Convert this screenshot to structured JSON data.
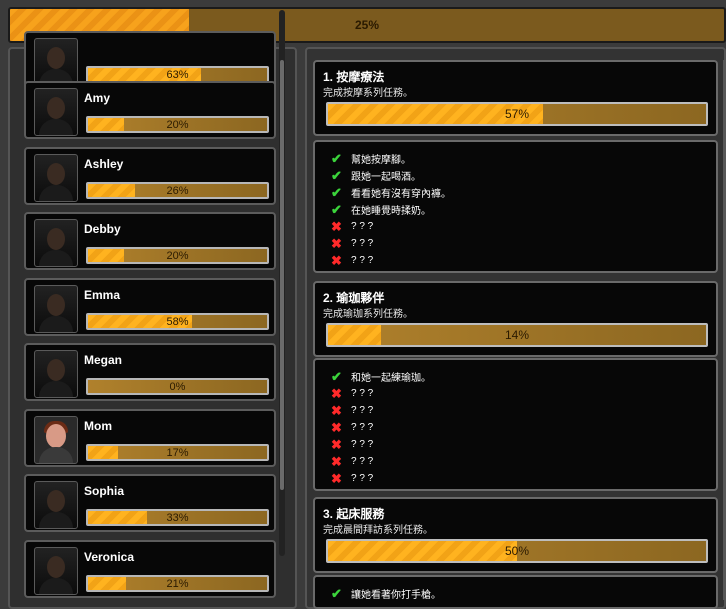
{
  "overall": {
    "progress_percent": 25,
    "label": "25%"
  },
  "characters": [
    {
      "name": "",
      "progress_percent": 63,
      "label": "63%"
    },
    {
      "name": "Amy",
      "progress_percent": 20,
      "label": "20%"
    },
    {
      "name": "Ashley",
      "progress_percent": 26,
      "label": "26%"
    },
    {
      "name": "Debby",
      "progress_percent": 20,
      "label": "20%"
    },
    {
      "name": "Emma",
      "progress_percent": 58,
      "label": "58%"
    },
    {
      "name": "Megan",
      "progress_percent": 0,
      "label": "0%"
    },
    {
      "name": "Mom",
      "progress_percent": 17,
      "label": "17%"
    },
    {
      "name": "Sophia",
      "progress_percent": 33,
      "label": "33%"
    },
    {
      "name": "Veronica",
      "progress_percent": 21,
      "label": "21%"
    }
  ],
  "quests": [
    {
      "title": "1. 按摩療法",
      "description": "完成按摩系列任務。",
      "progress_percent": 57,
      "label": "57%",
      "tasks": [
        {
          "status": "done",
          "text": "幫她按摩腳。"
        },
        {
          "status": "done",
          "text": "跟她一起喝酒。"
        },
        {
          "status": "done",
          "text": "看看她有沒有穿內褲。"
        },
        {
          "status": "done",
          "text": "在她睡覺時揉奶。"
        },
        {
          "status": "locked",
          "text": "? ? ?"
        },
        {
          "status": "locked",
          "text": "? ? ?"
        },
        {
          "status": "locked",
          "text": "? ? ?"
        }
      ]
    },
    {
      "title": "2. 瑜珈夥伴",
      "description": "完成瑜珈系列任務。",
      "progress_percent": 14,
      "label": "14%",
      "tasks": [
        {
          "status": "done",
          "text": "和她一起練瑜珈。"
        },
        {
          "status": "locked",
          "text": "? ? ?"
        },
        {
          "status": "locked",
          "text": "? ? ?"
        },
        {
          "status": "locked",
          "text": "? ? ?"
        },
        {
          "status": "locked",
          "text": "? ? ?"
        },
        {
          "status": "locked",
          "text": "? ? ?"
        },
        {
          "status": "locked",
          "text": "? ? ?"
        }
      ]
    },
    {
      "title": "3. 起床服務",
      "description": "完成晨間拜訪系列任務。",
      "progress_percent": 50,
      "label": "50%",
      "tasks": [
        {
          "status": "done",
          "text": "讓她看著你打手槍。"
        }
      ]
    }
  ],
  "icons": {
    "done": "check-icon",
    "locked": "cross-icon",
    "portrait": "avatar"
  },
  "colors": {
    "accent": "#f7a21c",
    "bar_empty": "#9a7026",
    "done": "#3bd43b",
    "locked": "#ff2a2a"
  }
}
